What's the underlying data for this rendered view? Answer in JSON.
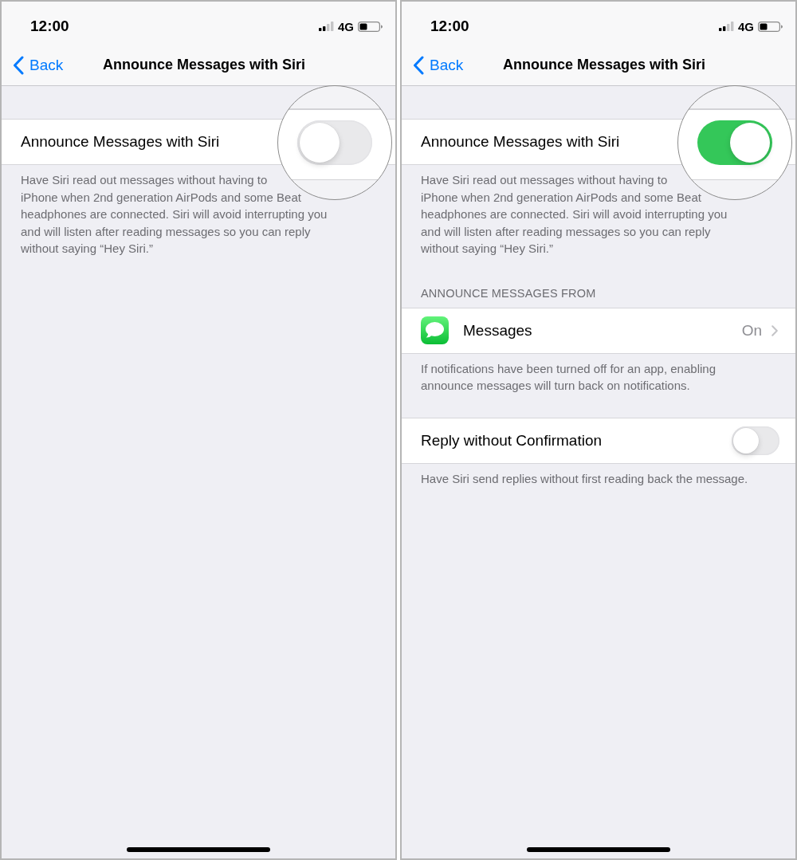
{
  "screens": [
    {
      "status_bar": {
        "time": "12:00",
        "network": "4G"
      },
      "nav_bar": {
        "back": "Back",
        "title": "Announce Messages with Siri"
      },
      "sections": [
        {
          "rows": [
            {
              "kind": "toggle",
              "label": "Announce Messages with Siri",
              "on": false,
              "magnified": true
            }
          ],
          "footer": "Have Siri read out messages without having to\niPhone when 2nd generation AirPods and some Beat\nheadphones are connected. Siri will avoid interrupting you\nand will listen after reading messages so you can reply\nwithout saying “Hey Siri.”"
        }
      ]
    },
    {
      "status_bar": {
        "time": "12:00",
        "network": "4G"
      },
      "nav_bar": {
        "back": "Back",
        "title": "Announce Messages with Siri"
      },
      "sections": [
        {
          "rows": [
            {
              "kind": "toggle",
              "label": "Announce Messages with Siri",
              "on": true,
              "magnified": true
            }
          ],
          "footer": "Have Siri read out messages without having to\niPhone when 2nd generation AirPods and some Beat\nheadphones are connected. Siri will avoid interrupting you\nand will listen after reading messages so you can reply\nwithout saying “Hey Siri.”"
        },
        {
          "header": "ANNOUNCE MESSAGES FROM",
          "rows": [
            {
              "kind": "link",
              "label": "Messages",
              "value": "On"
            }
          ],
          "footer": "If notifications have been turned off for an app, enabling\nannounce messages will turn back on notifications."
        },
        {
          "rows": [
            {
              "kind": "toggle",
              "label": "Reply without Confirmation",
              "on": false,
              "magnified": false
            }
          ],
          "footer": "Have Siri send replies without first reading back the message."
        }
      ]
    }
  ]
}
